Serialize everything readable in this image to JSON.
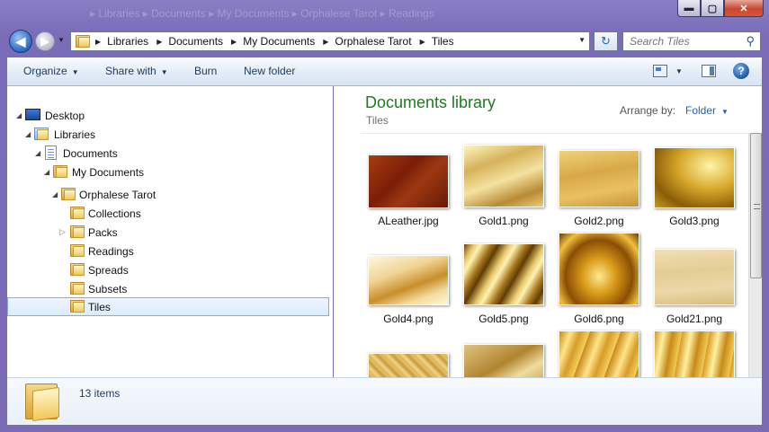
{
  "titlebar": {
    "ghost_title": "▸ Libraries ▸ Documents ▸ My Documents ▸ Orphalese Tarot ▸ Readings",
    "min": "▬",
    "max": "▢",
    "close": "✕"
  },
  "nav": {
    "back_glyph": "◀",
    "forward_glyph": "▶",
    "history_glyph": "▼",
    "breadcrumbs": [
      "Libraries",
      "Documents",
      "My Documents",
      "Orphalese Tarot",
      "Tiles"
    ],
    "sep_glyph": "▶",
    "dropdown_glyph": "▼",
    "refresh_glyph": "↻",
    "search_placeholder": "Search Tiles",
    "search_glyph": "⚲"
  },
  "toolbar": {
    "organize": "Organize",
    "share_with": "Share with",
    "burn": "Burn",
    "new_folder": "New folder",
    "arrow": "▼",
    "help": "?"
  },
  "tree": [
    {
      "label": "Desktop",
      "icon": "desktop-icon",
      "expanded": true
    },
    {
      "label": "Libraries",
      "icon": "libraries-icon",
      "expanded": true
    },
    {
      "label": "Documents",
      "icon": "documents-icon",
      "expanded": true
    },
    {
      "label": "My Documents",
      "icon": "documents-folder-icon",
      "expanded": true
    },
    {
      "label": "Orphalese Tarot",
      "icon": "folder-icon",
      "expanded": true
    },
    {
      "label": "Collections",
      "icon": "folder-icon"
    },
    {
      "label": "Packs",
      "icon": "folder-icon",
      "expanded": false
    },
    {
      "label": "Readings",
      "icon": "folder-icon"
    },
    {
      "label": "Spreads",
      "icon": "folder-icon"
    },
    {
      "label": "Subsets",
      "icon": "folder-icon"
    },
    {
      "label": "Tiles",
      "icon": "folder-icon",
      "selected": true
    }
  ],
  "library": {
    "title": "Documents library",
    "subtitle": "Tiles",
    "arrange_label": "Arrange by:",
    "arrange_value": "Folder"
  },
  "files": [
    {
      "name": "ALeather.jpg"
    },
    {
      "name": "Gold1.png"
    },
    {
      "name": "Gold2.png"
    },
    {
      "name": "Gold3.png"
    },
    {
      "name": "Gold4.png"
    },
    {
      "name": "Gold5.png"
    },
    {
      "name": "Gold6.png"
    },
    {
      "name": "Gold21.png"
    },
    {
      "name": ""
    },
    {
      "name": ""
    },
    {
      "name": ""
    },
    {
      "name": ""
    }
  ],
  "details": {
    "count": "13 items"
  },
  "colors": {
    "library_title": "#1e7a1e",
    "link_blue": "#1e62b4",
    "selection_border": "#84acdd"
  }
}
